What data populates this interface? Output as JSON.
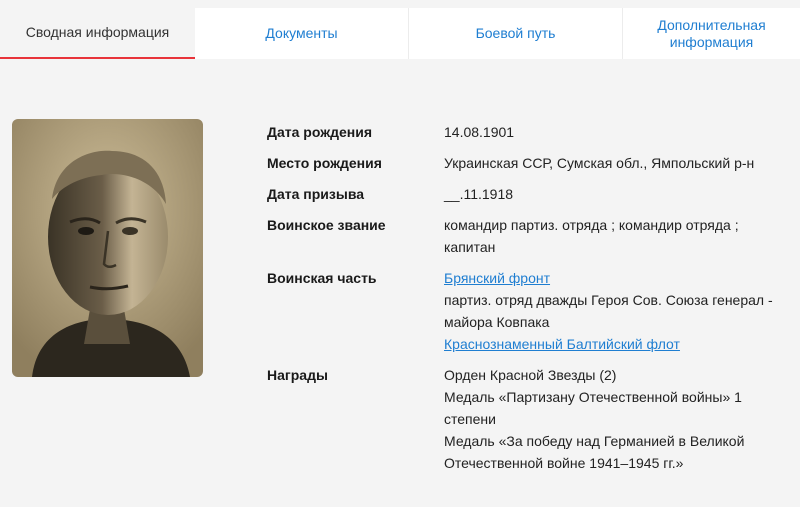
{
  "tabs": [
    {
      "label": "Сводная информация",
      "active": true
    },
    {
      "label": "Документы",
      "active": false
    },
    {
      "label": "Боевой путь",
      "active": false
    },
    {
      "label": "Дополнительная информация",
      "active": false
    }
  ],
  "photo": {
    "icon": "portrait-photo"
  },
  "fields": {
    "birth_date": {
      "label": "Дата рождения",
      "value": "14.08.1901"
    },
    "birth_place": {
      "label": "Место рождения",
      "value": "Украинская ССР, Сумская обл., Ямпольский р-н"
    },
    "draft_date": {
      "label": "Дата призыва",
      "value": "__.11.1918"
    },
    "rank": {
      "label": "Воинское звание",
      "value": "командир партиз. отряда ; командир отряда ; капитан"
    },
    "unit": {
      "label": "Воинская часть",
      "link1": "Брянский фронт",
      "text": "партиз. отряд дважды Героя Сов. Союза генерал - майора Ковпака",
      "link2": "Краснознаменный Балтийский флот"
    },
    "awards": {
      "label": "Награды",
      "items": [
        "Орден Красной Звезды (2)",
        "Медаль «Партизану Отечественной войны» 1 степени",
        "Медаль «За победу над Германией в Великой Отечественной войне 1941–1945 гг.»"
      ]
    }
  },
  "colors": {
    "accent": "#e8333a",
    "link": "#1f7ed1",
    "background": "#f4f4f4"
  }
}
